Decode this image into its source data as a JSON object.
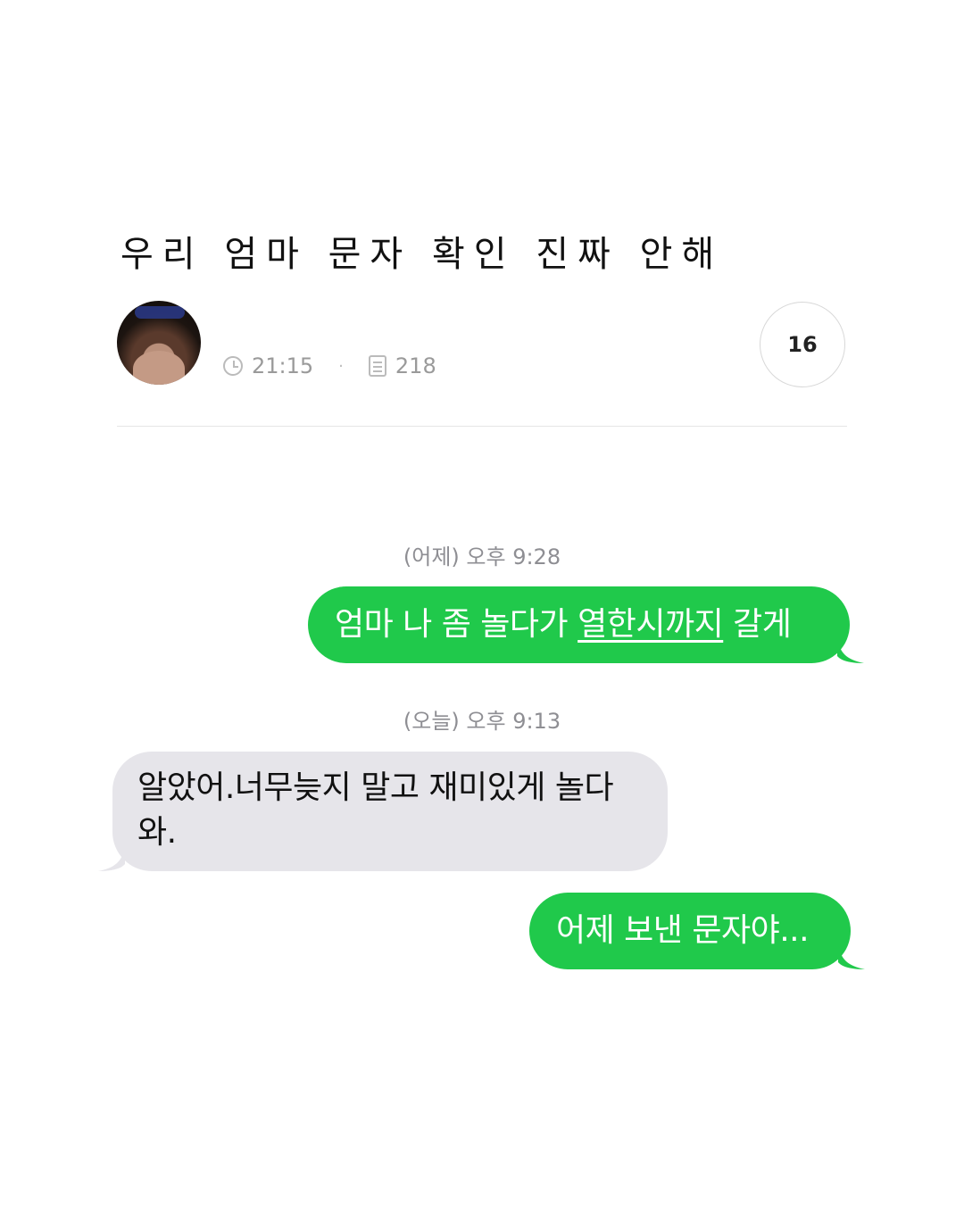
{
  "post": {
    "title": "우리 엄마 문자 확인 진짜 안해",
    "time": "21:15",
    "views": "218",
    "comment_count": "16"
  },
  "messages": [
    {
      "timestamp": "(어제) 오후 9:28"
    },
    {
      "text_before": "엄마 나 좀 놀다가 ",
      "text_link": "열한시까지",
      "text_after": " 갈게"
    },
    {
      "timestamp": "(오늘) 오후 9:13"
    },
    {
      "text": "알았어.너무늦지  말고 재미있게  놀다와."
    },
    {
      "text": "어제 보낸 문자야..."
    }
  ],
  "colors": {
    "sent_bubble": "#20c94b",
    "received_bubble": "#e6e5ea"
  }
}
